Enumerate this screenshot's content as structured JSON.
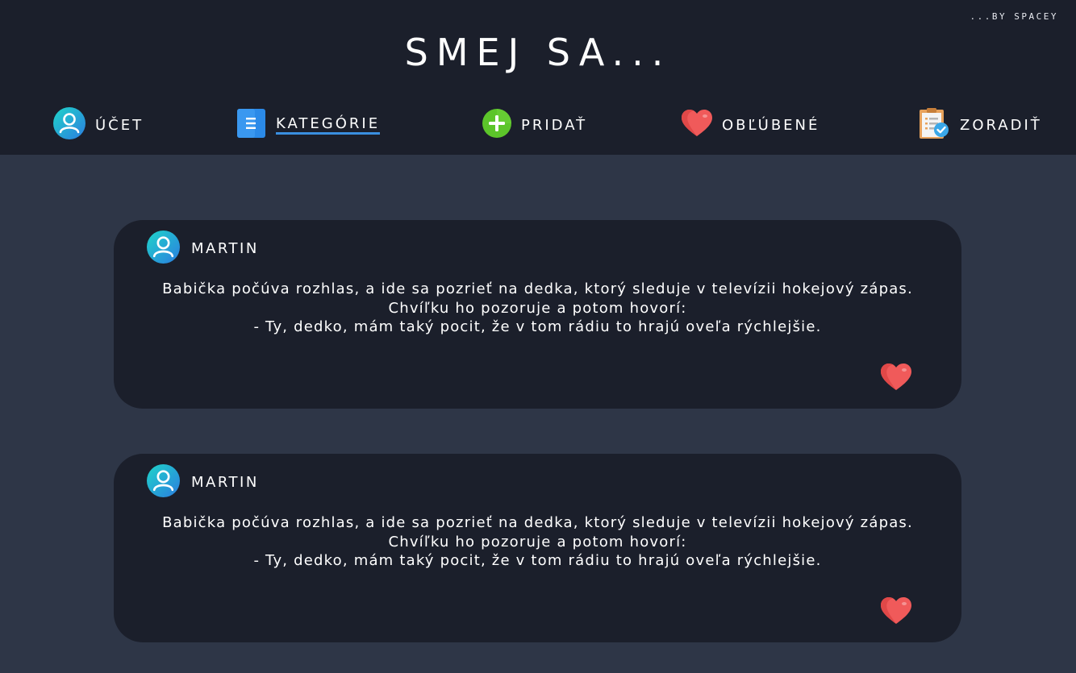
{
  "header": {
    "brand": "...BY SPACEY",
    "title": "SMEJ SA..."
  },
  "nav": [
    {
      "label": "ÚČET",
      "icon": "user-icon",
      "active": false
    },
    {
      "label": "KATEGÓRIE",
      "icon": "document-list-icon",
      "active": true
    },
    {
      "label": "PRIDAŤ",
      "icon": "plus-circle-icon",
      "active": false
    },
    {
      "label": "OBĽÚBENÉ",
      "icon": "heart-icon",
      "active": false
    },
    {
      "label": "ZORADIŤ",
      "icon": "clipboard-check-icon",
      "active": false
    }
  ],
  "jokes": [
    {
      "author": "MARTIN",
      "text": "Babička počúva rozhlas, a ide sa pozrieť na dedka, ktorý sleduje v televízii hokejový zápas. Chvíľku ho pozoruje a potom hovorí:\n- Ty, dedko, mám taký pocit, že v tom rádiu to hrajú oveľa rýchlejšie.",
      "icon": "heart-icon"
    },
    {
      "author": "MARTIN",
      "text": "Babička počúva rozhlas, a ide sa pozrieť na dedka, ktorý sleduje v televízii hokejový zápas. Chvíľku ho pozoruje a potom hovorí:\n- Ty, dedko, mám taký pocit, že v tom rádiu to hrajú oveľa rýchlejšie.",
      "icon": "heart-icon"
    }
  ],
  "colors": {
    "header_bg": "#1b1f2b",
    "page_bg": "#2e3647",
    "card_bg": "#1b1f2b",
    "accent_blue": "#3a8fe0",
    "heart_red": "#f05a5a",
    "avatar_gradient_start": "#1fd4c9",
    "avatar_gradient_end": "#2b7de0",
    "plus_green": "#5cc52a"
  }
}
